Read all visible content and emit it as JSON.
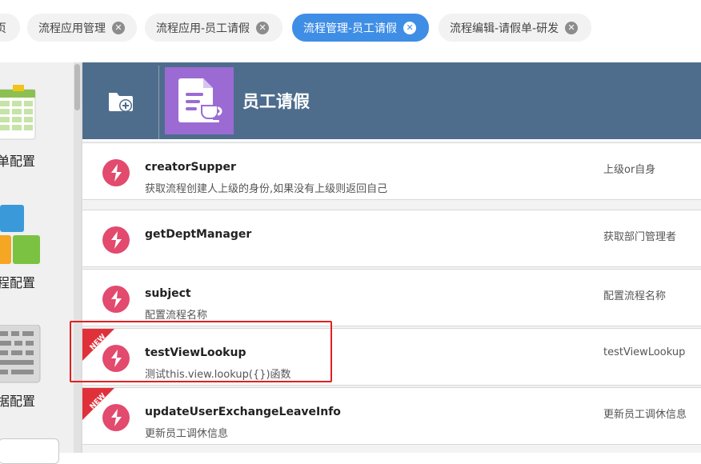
{
  "tabs": [
    {
      "label": "页"
    },
    {
      "label": "流程应用管理"
    },
    {
      "label": "流程应用-员工请假"
    },
    {
      "label": "流程管理-员工请假",
      "active": true
    },
    {
      "label": "流程编辑-请假单-研发"
    }
  ],
  "tab_close_symbol": "✕",
  "sidebar": {
    "items": [
      {
        "label": "单配置",
        "icon": "spreadsheet-icon"
      },
      {
        "label": "程配置",
        "icon": "blocks-icon"
      },
      {
        "label": "据配置",
        "icon": "keyboard-icon"
      }
    ]
  },
  "header": {
    "title": "员工请假",
    "add_icon": "add-folder-icon",
    "app_icon": "document-cup-icon",
    "app_icon_color": "#9b6bd3",
    "background": "#4e6d8d"
  },
  "functions": [
    {
      "name": "creatorSupper",
      "desc": "获取流程创建人上级的身份,如果没有上级则返回自己",
      "right": "上级or自身",
      "is_new": false
    },
    {
      "name": "getDeptManager",
      "desc": "",
      "right": "获取部门管理者",
      "is_new": false
    },
    {
      "name": "subject",
      "desc": "配置流程名称",
      "right": "配置流程名称",
      "is_new": false
    },
    {
      "name": "testViewLookup",
      "desc": "测试this.view.lookup({})函数",
      "right": "testViewLookup",
      "is_new": true
    },
    {
      "name": "updateUserExchangeLeaveInfo",
      "desc": "更新员工调休信息",
      "right": "更新员工调休信息",
      "is_new": true
    }
  ],
  "new_badge_text": "NEW",
  "colors": {
    "accent": "#3f8ee6",
    "function_icon": "#e24a6e",
    "new_badge": "#e0303a",
    "highlight": "#e02020"
  }
}
